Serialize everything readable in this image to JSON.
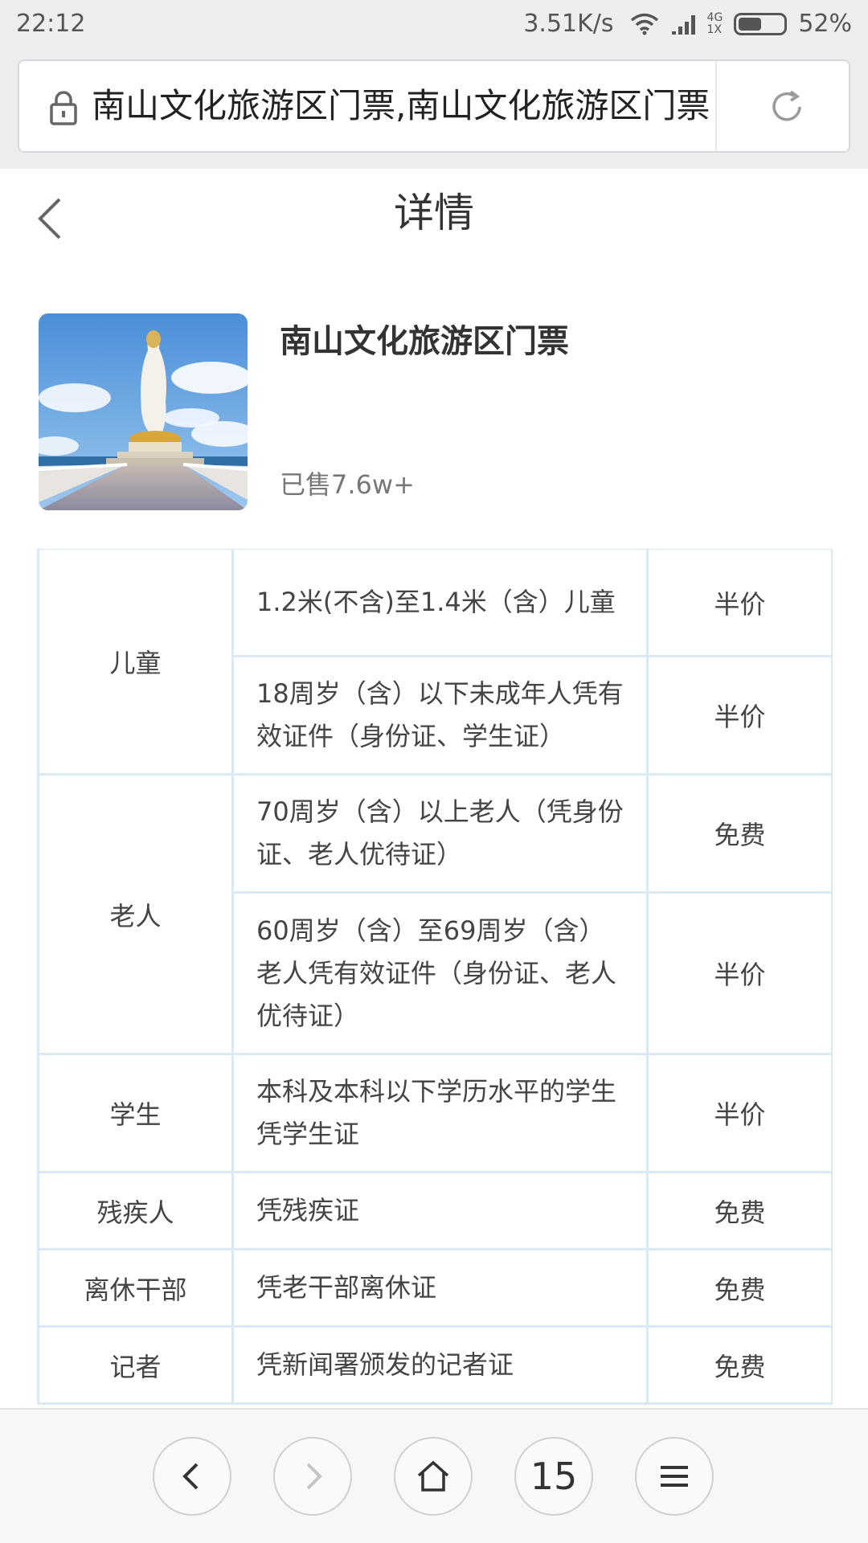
{
  "status_bar": {
    "time": "22:12",
    "net_speed": "3.51K/s",
    "net_type_top": "4G",
    "net_type_bottom": "1X",
    "battery": "52%"
  },
  "browser": {
    "url": "南山文化旅游区门票,南山文化旅游区门票价格"
  },
  "header": {
    "title": "详情"
  },
  "product": {
    "name": "南山文化旅游区门票",
    "sold": "已售7.6w+"
  },
  "table": {
    "rows": [
      {
        "category": "儿童",
        "description": "1.2米(不含)至1.4米（含）儿童",
        "price": "半价"
      },
      {
        "description": "18周岁（含）以下未成年人凭有效证件（身份证、学生证）",
        "price": "半价"
      },
      {
        "category": "老人",
        "description": "70周岁（含）以上老人（凭身份证、老人优待证）",
        "price": "免费"
      },
      {
        "description": "60周岁（含）至69周岁（含）老人凭有效证件（身份证、老人优待证）",
        "price": "半价"
      },
      {
        "category": "学生",
        "description": "本科及本科以下学历水平的学生凭学生证",
        "price": "半价"
      },
      {
        "category": "残疾人",
        "description": "凭残疾证",
        "price": "免费"
      },
      {
        "category": "离休干部",
        "description": "凭老干部离休证",
        "price": "免费"
      },
      {
        "category": "记者",
        "description": "凭新闻署颁发的记者证",
        "price": "免费"
      }
    ]
  },
  "bottom_nav": {
    "tab_count": "15"
  }
}
